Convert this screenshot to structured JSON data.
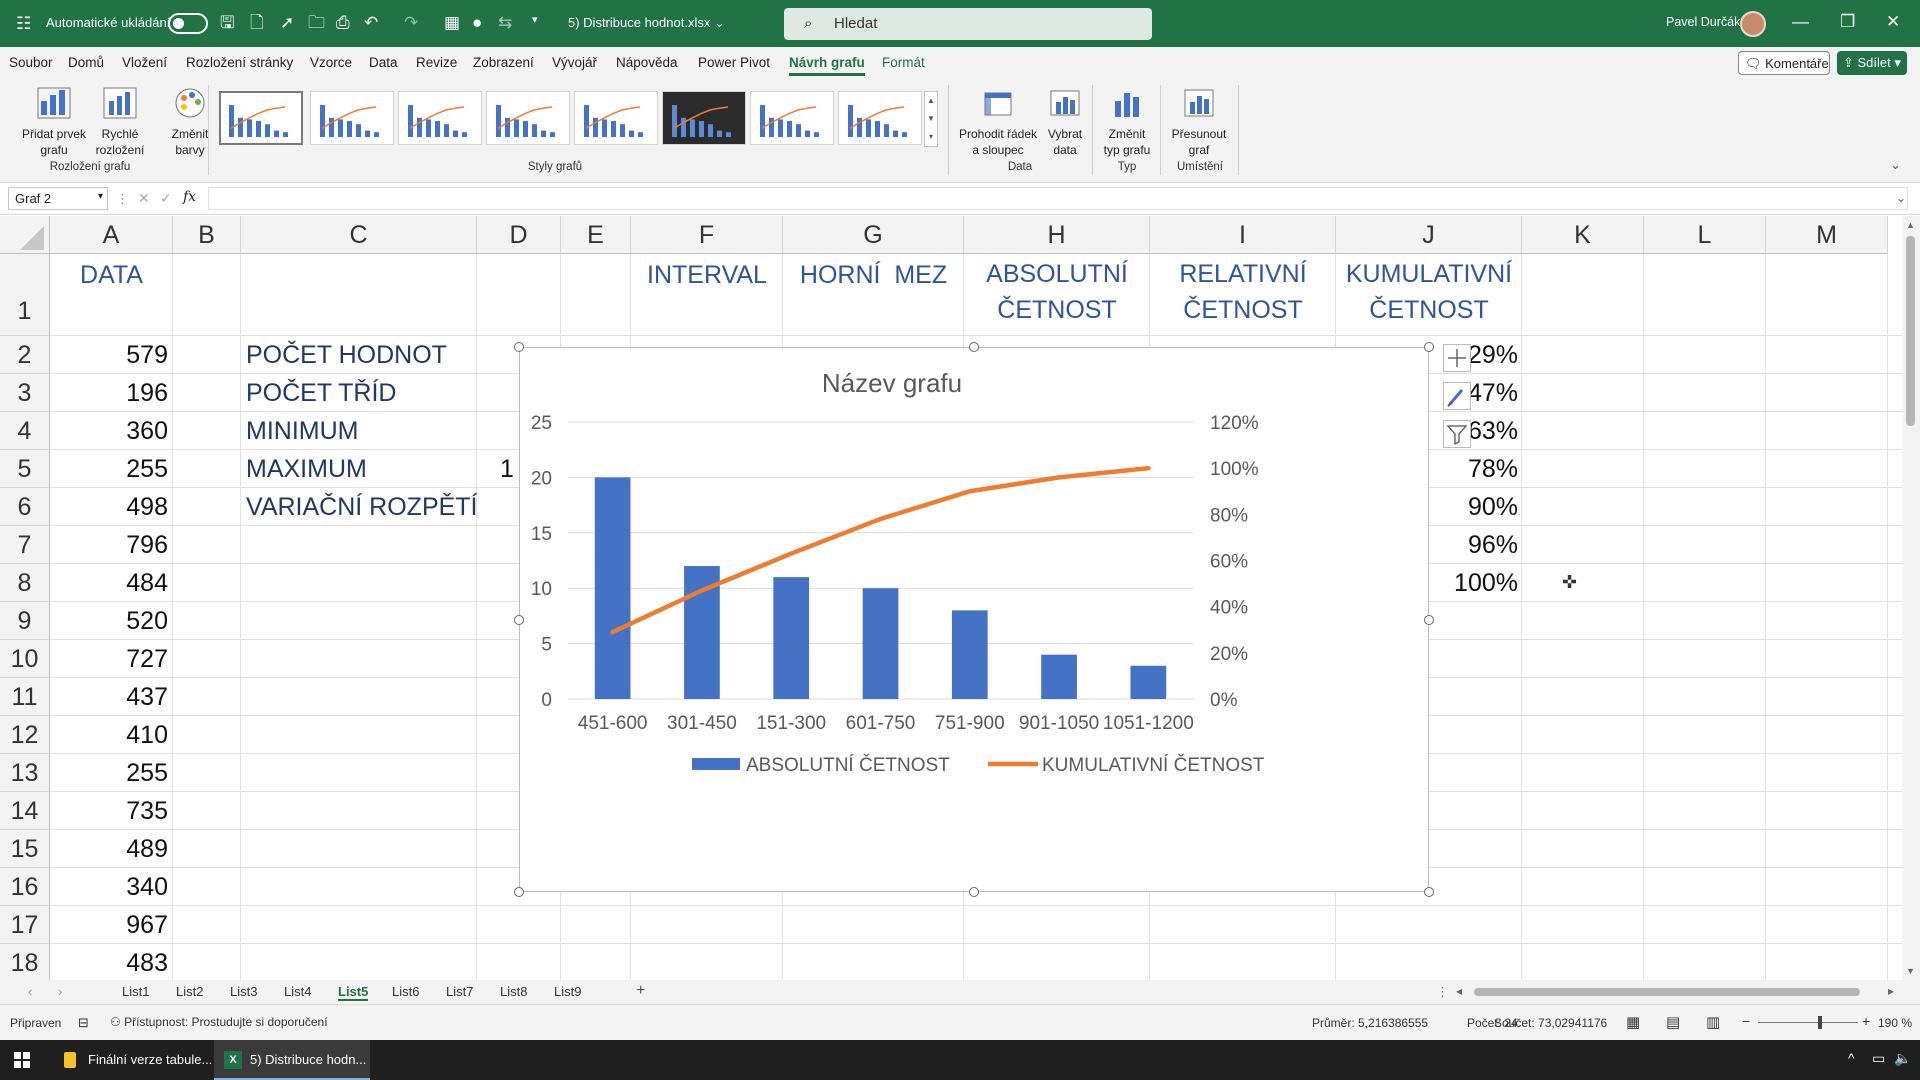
{
  "titlebar": {
    "autosave_label": "Automatické ukládání",
    "filename": "5) Distribuce hodnot.xlsx",
    "search_placeholder": "Hledat",
    "user": "Pavel Durčák"
  },
  "menu": {
    "items": [
      "Soubor",
      "Domů",
      "Vložení",
      "Rozložení stránky",
      "Vzorce",
      "Data",
      "Revize",
      "Zobrazení",
      "Vývojář",
      "Nápověda",
      "Power Pivot",
      "Návrh grafu",
      "Formát"
    ],
    "active": "Návrh grafu",
    "komentare": "Komentáře",
    "sdilet": "Sdílet"
  },
  "ribbon": {
    "pridat_prvek": "Přidat prvek grafu",
    "rychle_rozlozeni": "Rychlé rozložení",
    "zmenit_barvy": "Změnit barvy",
    "group_rozlozeni": "Rozložení grafu",
    "group_styly": "Styly grafů",
    "prohodit": "Prohodit řádek a sloupec",
    "vybrat_data": "Vybrat data",
    "group_data": "Data",
    "zmenit_typ": "Změnit typ grafu",
    "group_typ": "Typ",
    "presunout": "Přesunout graf",
    "group_umisteni": "Umístění"
  },
  "formulabar": {
    "namebox": "Graf 2",
    "fx": "fx",
    "formula": ""
  },
  "sheet": {
    "columns": [
      "A",
      "B",
      "C",
      "D",
      "E",
      "F",
      "G",
      "H",
      "I",
      "J",
      "K",
      "L",
      "M"
    ],
    "rows": [
      "1",
      "2",
      "3",
      "4",
      "5",
      "6",
      "7",
      "8",
      "9",
      "10",
      "11",
      "12",
      "13",
      "14",
      "15",
      "16",
      "17",
      "18"
    ],
    "header_data": "DATA",
    "header_interval": "INTERVAL",
    "header_horni": "HORNÍ  MEZ",
    "header_abs_1": "ABSOLUTNÍ",
    "header_abs_2": "ČETNOST",
    "header_rel_1": "RELATIVNÍ",
    "header_rel_2": "ČETNOST",
    "header_kum_1": "KUMULATIVNÍ",
    "header_kum_2": "ČETNOST",
    "data_values": [
      "579",
      "196",
      "360",
      "255",
      "498",
      "796",
      "484",
      "520",
      "727",
      "437",
      "410",
      "255",
      "735",
      "489",
      "340",
      "967",
      "483"
    ],
    "stats_labels": [
      "POČET HODNOT",
      "POČET TŘÍD",
      "MINIMUM",
      "MAXIMUM",
      "VARIAČNÍ ROZPĚTÍ"
    ],
    "d5_partial": "1",
    "kumulativni": [
      "29%",
      "47%",
      "63%",
      "78%",
      "90%",
      "96%",
      "100%"
    ]
  },
  "chart_data": {
    "type": "bar",
    "title": "Název grafu",
    "categories": [
      "451-600",
      "301-450",
      "151-300",
      "601-750",
      "751-900",
      "901-1050",
      "1051-1200"
    ],
    "series": [
      {
        "name": "ABSOLUTNÍ ČETNOST",
        "type": "bar",
        "axis": "left",
        "color": "#4472c4",
        "values": [
          20,
          12,
          11,
          10,
          8,
          4,
          3
        ]
      },
      {
        "name": "KUMULATIVNÍ ČETNOST",
        "type": "line",
        "axis": "right",
        "color": "#ed7d31",
        "values": [
          0.29,
          0.47,
          0.63,
          0.78,
          0.9,
          0.96,
          1.0
        ]
      }
    ],
    "y_left": {
      "min": 0,
      "max": 25,
      "ticks": [
        "0",
        "5",
        "10",
        "15",
        "20",
        "25"
      ]
    },
    "y_right": {
      "min": 0,
      "max": 1.2,
      "ticks": [
        "0%",
        "20%",
        "40%",
        "60%",
        "80%",
        "100%",
        "120%"
      ]
    },
    "gridlines": true,
    "legend_position": "bottom"
  },
  "tabs": {
    "sheets": [
      "List1",
      "List2",
      "List3",
      "List4",
      "List5",
      "List6",
      "List7",
      "List8",
      "List9"
    ],
    "active": "List5"
  },
  "status": {
    "ready": "Připraven",
    "accessibility": "Přístupnost: Prostudujte si doporučení",
    "prumer": "Průměr: 5,216386555",
    "pocet": "Počet: 24",
    "soucet": "Součet: 73,02941176",
    "zoom": "190 %"
  },
  "taskbar": {
    "item1": "Finální verze tabule...",
    "item2": "5) Distribuce hodn..."
  },
  "colors": {
    "excel_green": "#217346",
    "bar_blue": "#4472c4",
    "line_orange": "#ed7d31"
  }
}
